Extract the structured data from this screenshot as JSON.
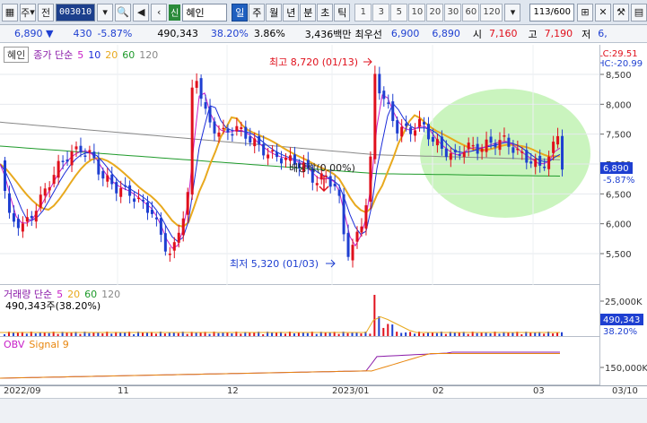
{
  "toolbar": {
    "type_label": "주",
    "prev_label": "전",
    "stock_code": "003010",
    "new_badge": "신",
    "stock_name": "혜인",
    "period_tabs": [
      "일",
      "주",
      "월",
      "년",
      "분",
      "초",
      "틱"
    ],
    "active_period": "일",
    "intervals": [
      "1",
      "3",
      "5",
      "10",
      "20",
      "30",
      "60",
      "120"
    ],
    "page_counter": "113/600"
  },
  "quote": {
    "price": "6,890 ▼",
    "change": "430",
    "change_pct": "-5.87%",
    "volume": "490,343",
    "vol_ratio": "38.20%",
    "turnover": "3.86%",
    "amount": "3,436백만",
    "best_ask_label": "최우선",
    "best_ask": "6,900",
    "best_bid": "6,890",
    "open_label": "시",
    "open": "7,160",
    "high_label": "고",
    "high": "7,190",
    "low_label": "저",
    "low": "6,"
  },
  "price_panel": {
    "name_chip": "혜인",
    "legend_title": "종가 단순",
    "ma_periods": [
      "5",
      "10",
      "20",
      "60",
      "120"
    ],
    "lc_label": "LC:29.51",
    "hc_label": "HC:-20.99",
    "max_annotation": "최고 8,720 (01/13)",
    "min_annotation": "최저 5,320 (01/03)",
    "dividend_annotation": "배당락(0.00%)",
    "current_price_tag": "6,890",
    "current_pct_tag": "-5.87%",
    "y_ticks": [
      "8,500",
      "8,000",
      "7,500",
      "7,000",
      "6,500",
      "6,000",
      "5,500"
    ]
  },
  "volume_panel": {
    "legend_title": "거래량 단순",
    "ma_periods": [
      "5",
      "20",
      "60",
      "120"
    ],
    "value_label": "490,343주(38.20%)",
    "y_tick": "25,000K",
    "current_tag": "490,343",
    "current_pct": "38.20%"
  },
  "obv_panel": {
    "legend_title": "OBV",
    "signal_label": "Signal 9",
    "y_tick": "150,000K"
  },
  "date_axis": [
    "2022/09",
    "11",
    "12",
    "2023/01",
    "02",
    "03",
    "03/10"
  ],
  "colors": {
    "up": "#e0101c",
    "down": "#1e3fd1",
    "ma5": "#c81ec8",
    "ma10": "#1a2bd9",
    "ma20": "#e8a91e",
    "ma60": "#1e9a2a",
    "ma120": "#888888",
    "highlight": "#b8f0a8"
  }
}
